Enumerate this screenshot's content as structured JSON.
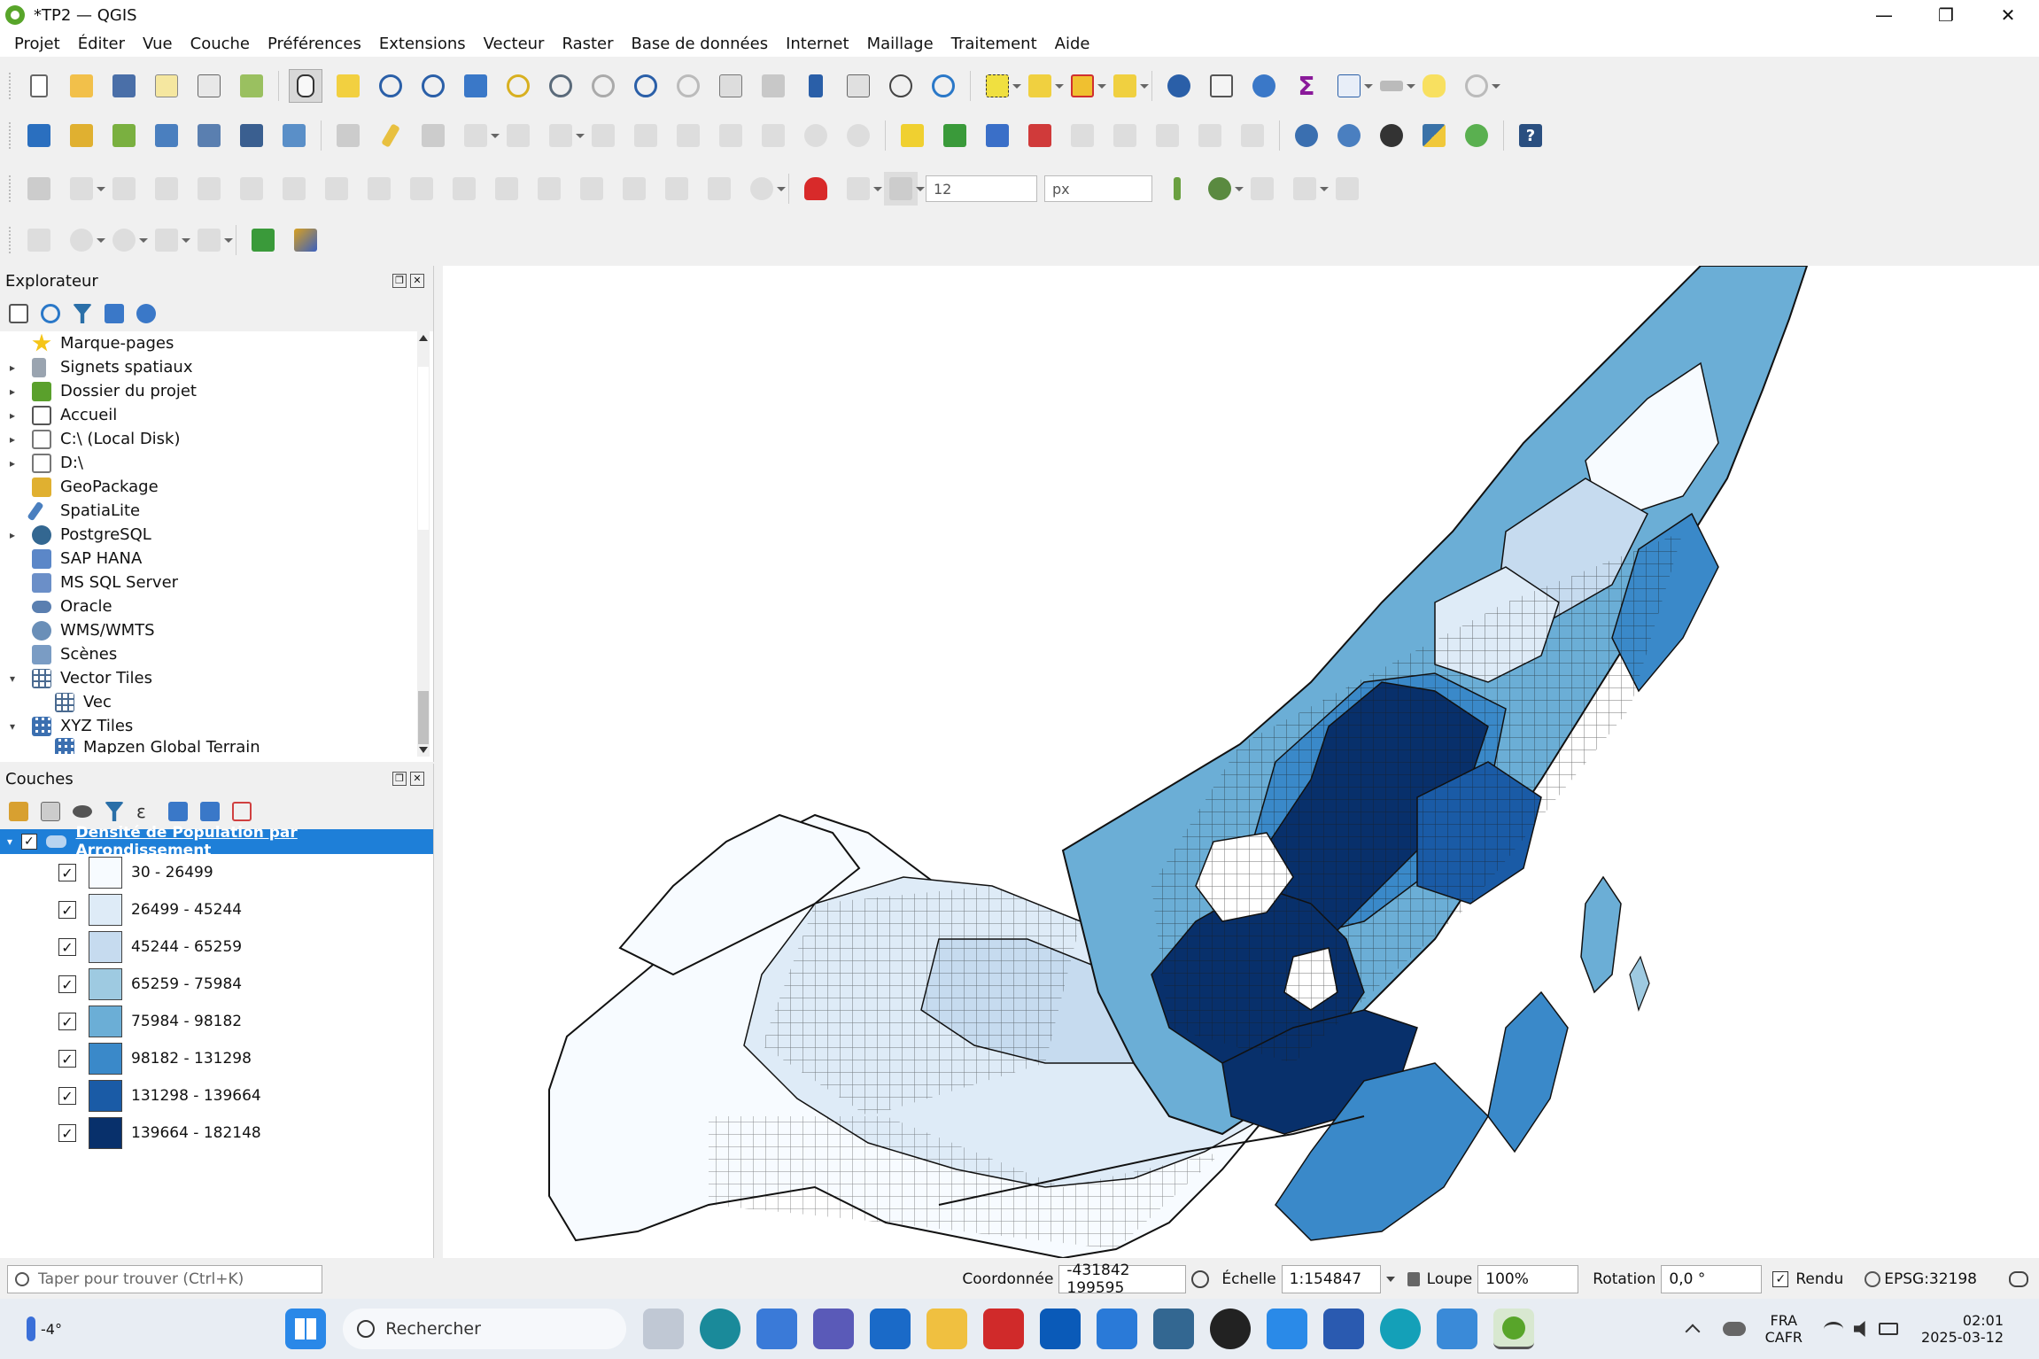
{
  "window": {
    "title": "*TP2 — QGIS",
    "minimize": "—",
    "maximize": "❐",
    "close": "✕"
  },
  "menu": [
    "Projet",
    "Éditer",
    "Vue",
    "Couche",
    "Préférences",
    "Extensions",
    "Vecteur",
    "Raster",
    "Base de données",
    "Internet",
    "Maillage",
    "Traitement",
    "Aide"
  ],
  "snapping": {
    "tolerance": "12",
    "unit": "px"
  },
  "explorer": {
    "title": "Explorateur",
    "items": [
      {
        "label": "Marque-pages",
        "arrow": "",
        "icon": "star-icon",
        "color": "#f5c518",
        "indent": 0
      },
      {
        "label": "Signets spatiaux",
        "arrow": "▸",
        "icon": "bookmark-icon",
        "color": "#9aa4b0",
        "indent": 0
      },
      {
        "label": "Dossier du projet",
        "arrow": "▸",
        "icon": "project-folder-icon",
        "color": "#5aa02c",
        "indent": 0
      },
      {
        "label": "Accueil",
        "arrow": "▸",
        "icon": "home-icon",
        "color": "#cfcfcf",
        "indent": 0
      },
      {
        "label": "C:\\ (Local Disk)",
        "arrow": "▸",
        "icon": "drive-icon",
        "color": "#d0d0d0",
        "indent": 0
      },
      {
        "label": "D:\\",
        "arrow": "▸",
        "icon": "drive-icon",
        "color": "#d0d0d0",
        "indent": 0
      },
      {
        "label": "GeoPackage",
        "arrow": "",
        "icon": "geopackage-icon",
        "color": "#e0b030",
        "indent": 0
      },
      {
        "label": "SpatiaLite",
        "arrow": "",
        "icon": "spatialite-icon",
        "color": "#4a7fbf",
        "indent": 0
      },
      {
        "label": "PostgreSQL",
        "arrow": "▸",
        "icon": "postgresql-icon",
        "color": "#336791",
        "indent": 0
      },
      {
        "label": "SAP HANA",
        "arrow": "",
        "icon": "sap-hana-icon",
        "color": "#5b87c8",
        "indent": 0
      },
      {
        "label": "MS SQL Server",
        "arrow": "",
        "icon": "mssql-icon",
        "color": "#6b8fc8",
        "indent": 0
      },
      {
        "label": "Oracle",
        "arrow": "",
        "icon": "oracle-icon",
        "color": "#5a7fb0",
        "indent": 0
      },
      {
        "label": "WMS/WMTS",
        "arrow": "",
        "icon": "wms-icon",
        "color": "#6a8fb8",
        "indent": 0
      },
      {
        "label": "Scènes",
        "arrow": "",
        "icon": "scenes-icon",
        "color": "#7a9cc4",
        "indent": 0
      },
      {
        "label": "Vector Tiles",
        "arrow": "▾",
        "icon": "grid-icon",
        "color": "#4a6a90",
        "indent": 0
      },
      {
        "label": "Vec",
        "arrow": "",
        "icon": "grid-icon",
        "color": "#4a6a90",
        "indent": 1
      },
      {
        "label": "XYZ Tiles",
        "arrow": "▾",
        "icon": "tiles-icon",
        "color": "#3b6fb0",
        "indent": 0
      },
      {
        "label": "Mapzen Global Terrain",
        "arrow": "",
        "icon": "tiles-icon",
        "color": "#3b6fb0",
        "indent": 1
      }
    ]
  },
  "layers": {
    "title": "Couches",
    "layer_name": "Densité de Population par Arrondissement",
    "classes": [
      {
        "label": "30 - 26499",
        "color": "#f7fbff"
      },
      {
        "label": "26499 - 45244",
        "color": "#deebf7"
      },
      {
        "label": "45244 - 65259",
        "color": "#c6dbef"
      },
      {
        "label": "65259 - 75984",
        "color": "#9ecae1"
      },
      {
        "label": "75984 - 98182",
        "color": "#6baed6"
      },
      {
        "label": "98182 - 131298",
        "color": "#3a89c9"
      },
      {
        "label": "131298 - 139664",
        "color": "#1a5ba6"
      },
      {
        "label": "139664 - 182148",
        "color": "#08306b"
      }
    ]
  },
  "status": {
    "search_placeholder": "Taper pour trouver (Ctrl+K)",
    "coord_label": "Coordonnée",
    "coord_value": "-431842  199595",
    "scale_label": "Échelle",
    "scale_value": "1:154847",
    "magnifier_label": "Loupe",
    "magnifier_value": "100%",
    "rotation_label": "Rotation",
    "rotation_value": "0,0 °",
    "render_label": "Rendu",
    "crs": "EPSG:32198"
  },
  "taskbar": {
    "weather": "-4°",
    "search": "Rechercher",
    "lang1": "FRA",
    "lang2": "CAFR",
    "time": "02:01",
    "date": "2025-03-12"
  }
}
